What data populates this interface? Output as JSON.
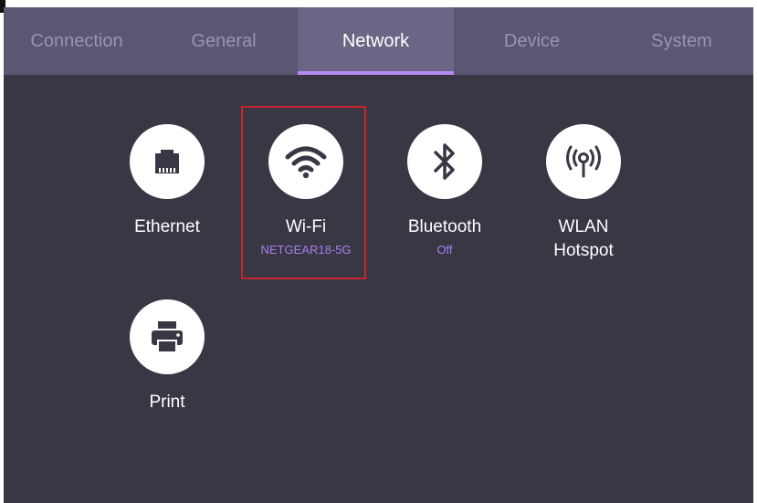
{
  "tabs": [
    {
      "label": "Connection"
    },
    {
      "label": "General"
    },
    {
      "label": "Network"
    },
    {
      "label": "Device"
    },
    {
      "label": "System"
    }
  ],
  "active_tab": "Network",
  "tiles": {
    "ethernet": {
      "label": "Ethernet",
      "icon": "ethernet-port-icon"
    },
    "wifi": {
      "label": "Wi-Fi",
      "status": "NETGEAR18-5G",
      "icon": "wifi-icon"
    },
    "bluetooth": {
      "label": "Bluetooth",
      "status": "Off",
      "icon": "bluetooth-icon"
    },
    "wlan_hotspot": {
      "label_line1": "WLAN",
      "label_line2": "Hotspot",
      "icon": "hotspot-antenna-icon"
    },
    "print": {
      "label": "Print",
      "icon": "printer-icon"
    }
  },
  "colors": {
    "panel_bg": "#3a3744",
    "tabbar_bg": "#5b5673",
    "active_tab_bg": "#6c6585",
    "accent": "#b28cf0",
    "status_text": "#a87ff0",
    "highlight": "#c8232f"
  }
}
